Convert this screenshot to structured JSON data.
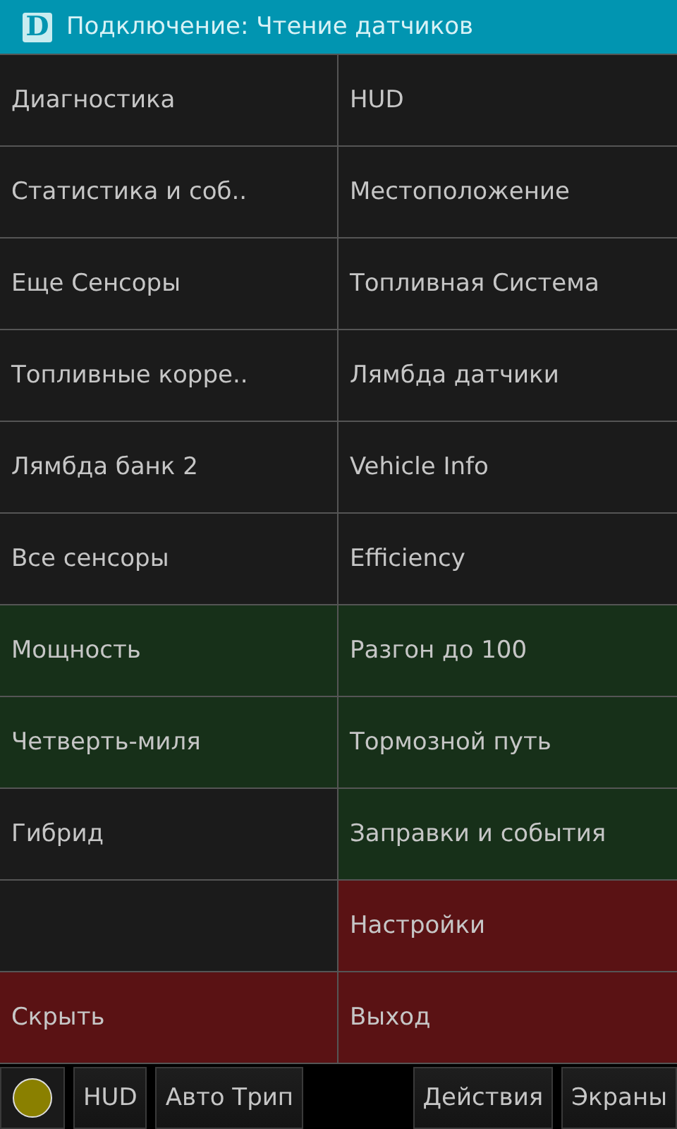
{
  "header": {
    "logo_letter": "D",
    "title": "Подключение: Чтение датчиков"
  },
  "tiles": [
    {
      "label": "Диагностика",
      "color": "#1b1b1b"
    },
    {
      "label": "HUD",
      "color": "#1b1b1b"
    },
    {
      "label": "Статистика и соб..",
      "color": "#1b1b1b"
    },
    {
      "label": "Местоположение",
      "color": "#1b1b1b"
    },
    {
      "label": "Еще Сенсоры",
      "color": "#1b1b1b"
    },
    {
      "label": "Топливная Система",
      "color": "#1b1b1b"
    },
    {
      "label": "Топливные корре..",
      "color": "#1b1b1b"
    },
    {
      "label": "Лямбда датчики",
      "color": "#1b1b1b"
    },
    {
      "label": "Лямбда банк 2",
      "color": "#1b1b1b"
    },
    {
      "label": "Vehicle Info",
      "color": "#1b1b1b"
    },
    {
      "label": "Все сенсоры",
      "color": "#1b1b1b"
    },
    {
      "label": "Efficiency",
      "color": "#1b1b1b"
    },
    {
      "label": "Мощность",
      "color": "#173019"
    },
    {
      "label": "Разгон до 100",
      "color": "#173019"
    },
    {
      "label": "Четверть-миля",
      "color": "#173019"
    },
    {
      "label": "Тормозной путь",
      "color": "#173019"
    },
    {
      "label": "Гибрид",
      "color": "#1b1b1b"
    },
    {
      "label": "Заправки и события",
      "color": "#173019"
    },
    {
      "color": "#1b1b1b"
    },
    {
      "label": "Настройки",
      "color": "#5a1214"
    },
    {
      "label": "Скрыть",
      "color": "#5a1214"
    },
    {
      "label": "Выход",
      "color": "#5a1214"
    }
  ],
  "bottom_bar": {
    "status_dot": {
      "color": "#8a8000"
    },
    "left_buttons": [
      "HUD",
      "Авто Трип"
    ],
    "right_buttons": [
      "Действия",
      "Экраны"
    ]
  }
}
